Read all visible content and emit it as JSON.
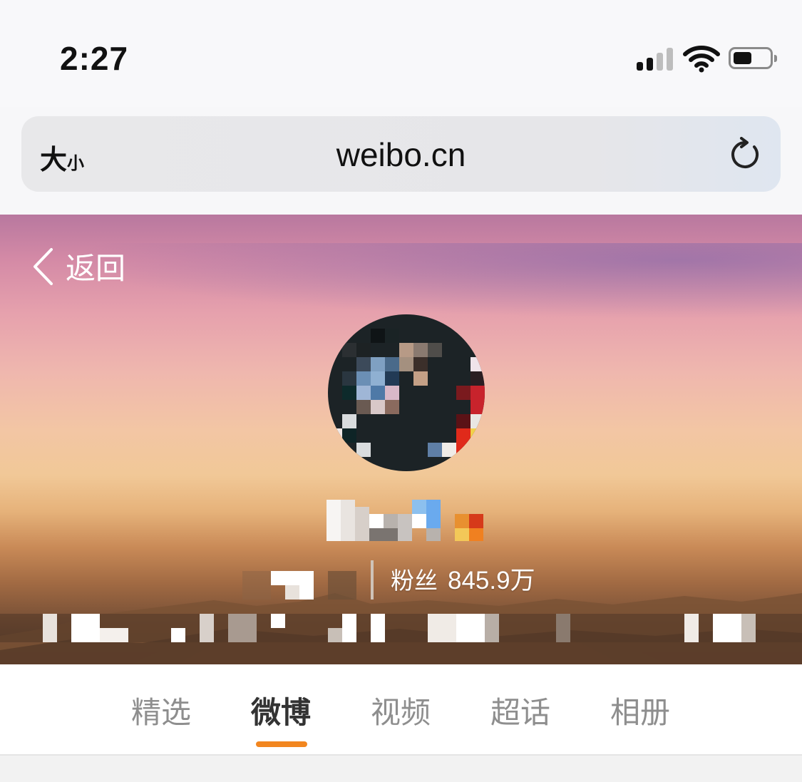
{
  "status_bar": {
    "time": "2:27",
    "signal_icon": "cellular-signal-icon",
    "wifi_icon": "wifi-icon",
    "battery_icon": "battery-icon"
  },
  "browser": {
    "text_size_big": "大",
    "text_size_small": "小",
    "url": "weibo.cn",
    "reload_icon": "reload-icon"
  },
  "profile": {
    "back_label": "返回",
    "back_icon": "chevron-left-icon",
    "fans_label": "粉丝",
    "fans_count": "845.9万"
  },
  "tabs": [
    {
      "label": "精选",
      "active": false
    },
    {
      "label": "微博",
      "active": true
    },
    {
      "label": "视频",
      "active": false
    },
    {
      "label": "超话",
      "active": false
    },
    {
      "label": "相册",
      "active": false
    }
  ],
  "colors": {
    "accent": "#f2861f",
    "tab_inactive": "#8e8e8e",
    "tab_active": "#333333"
  }
}
